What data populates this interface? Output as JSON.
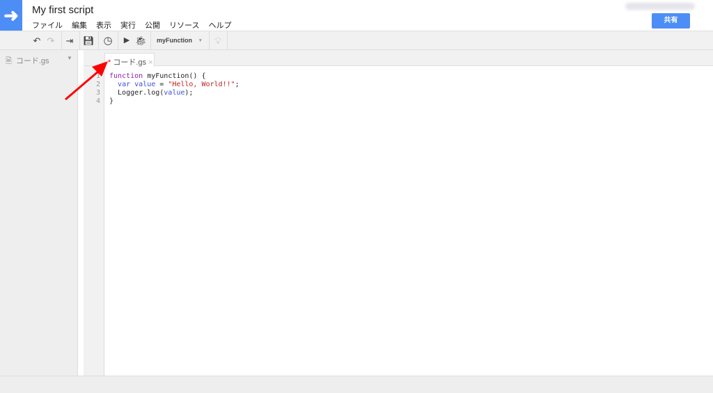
{
  "header": {
    "title": "My first script",
    "share_label": "共有",
    "logo_icon": "arrow-right-icon",
    "menu": [
      "ファイル",
      "編集",
      "表示",
      "実行",
      "公開",
      "リソース",
      "ヘルプ"
    ]
  },
  "toolbar": {
    "function_select": "myFunction"
  },
  "sidebar": {
    "file": "コード.gs"
  },
  "tab": {
    "modified": "*",
    "name": "コード.gs"
  },
  "editor": {
    "line_numbers": [
      "1",
      "2",
      "3",
      "4"
    ],
    "lines": [
      {
        "kw": "function",
        "rest": " myFunction() {"
      },
      {
        "pre": "  ",
        "kw": "var",
        "sp": " ",
        "var": "value",
        "eq": " = ",
        "str": "\"Hello, World!!\"",
        "end": ";"
      },
      {
        "pre": "  Logger.log(",
        "var": "value",
        "end": ");"
      },
      {
        "text": "}"
      }
    ]
  },
  "colors": {
    "accent": "#4d8ef6",
    "annotation_arrow": "#ff0000"
  }
}
